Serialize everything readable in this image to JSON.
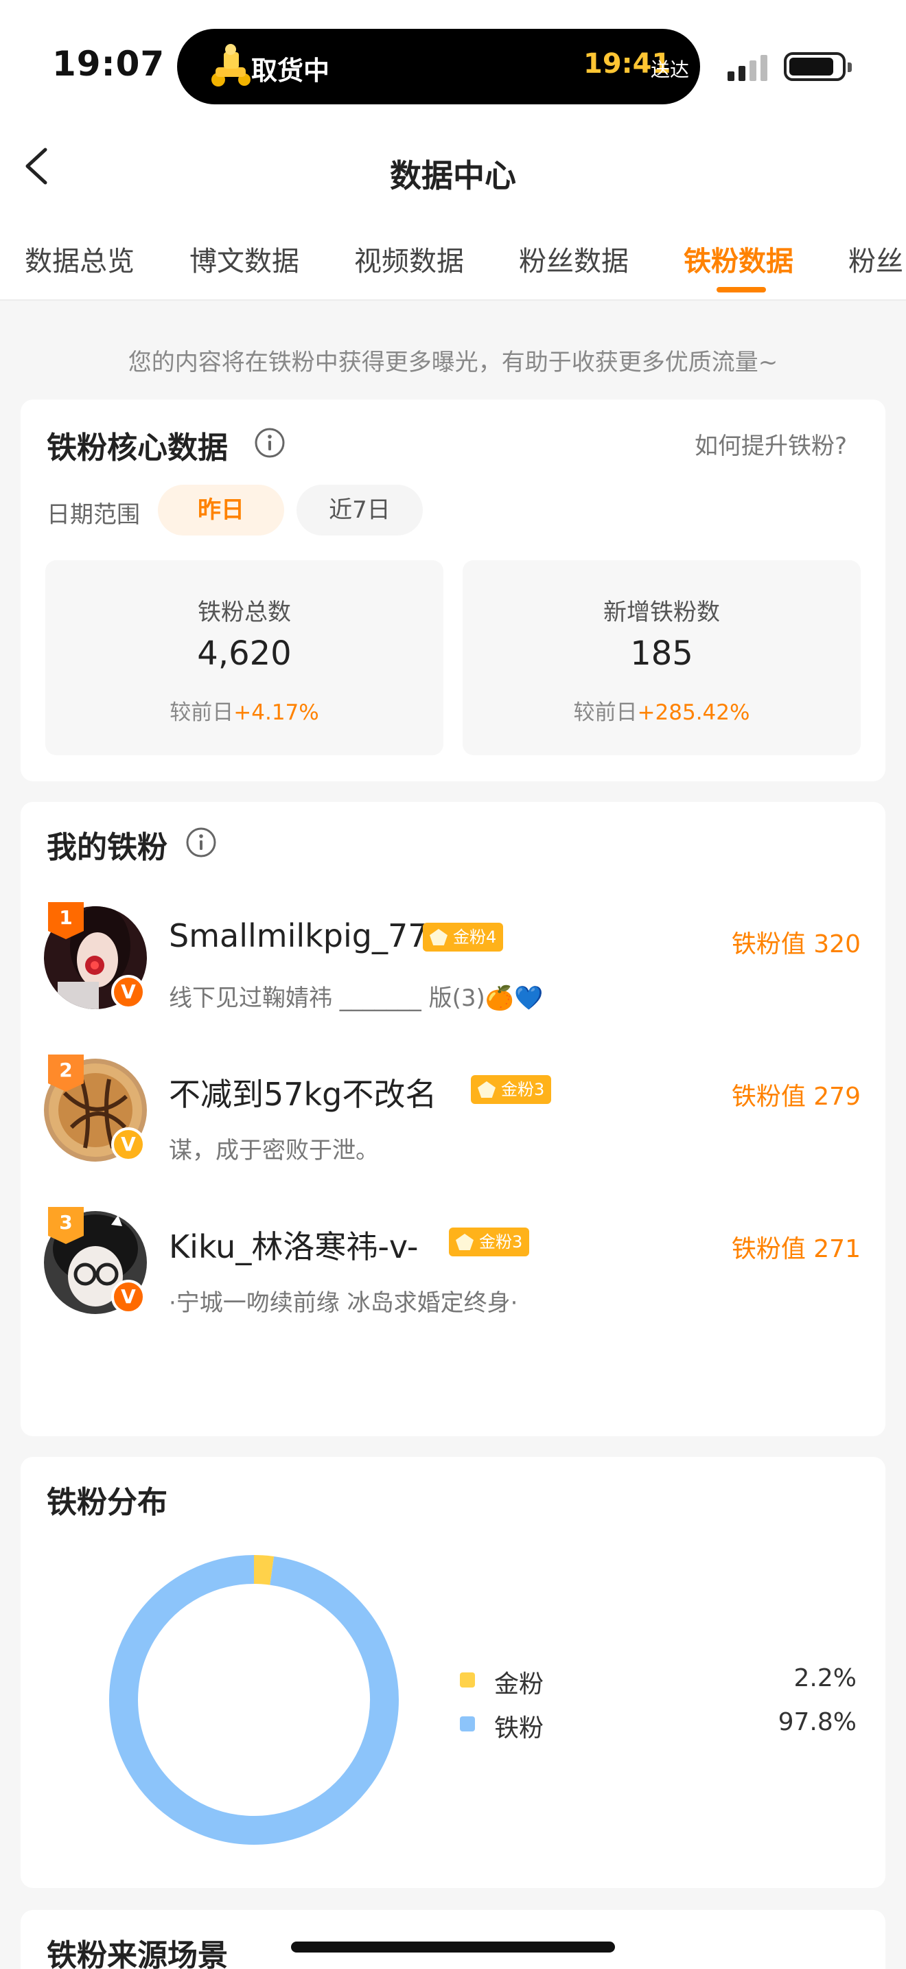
{
  "status_bar": {
    "time": "19:07",
    "island_status": "取货中",
    "island_eta": "19:41",
    "island_eta_suffix": "送达"
  },
  "header": {
    "title": "数据中心"
  },
  "tabs": [
    {
      "label": "数据总览"
    },
    {
      "label": "博文数据"
    },
    {
      "label": "视频数据"
    },
    {
      "label": "粉丝数据"
    },
    {
      "label": "铁粉数据",
      "active": true
    },
    {
      "label": "粉丝"
    }
  ],
  "tip": "您的内容将在铁粉中获得更多曝光，有助于收获更多优质流量~",
  "core": {
    "title": "铁粉核心数据",
    "help_link": "如何提升铁粉?",
    "range_label": "日期范围",
    "ranges": [
      {
        "label": "昨日",
        "active": true
      },
      {
        "label": "近7日"
      }
    ],
    "stats": [
      {
        "label": "铁粉总数",
        "value": "4,620",
        "cmp_prefix": "较前日",
        "cmp_change": "+4.17%"
      },
      {
        "label": "新增铁粉数",
        "value": "185",
        "cmp_prefix": "较前日",
        "cmp_change": "+285.42%"
      }
    ]
  },
  "fans": {
    "title": "我的铁粉",
    "list": [
      {
        "rank": "1",
        "name": "Smallmilkpig_77",
        "medal": "金粉4",
        "bio": "线下见过鞠婧祎 _______ 版(3)🍊💙",
        "value": "铁粉值 320"
      },
      {
        "rank": "2",
        "name": "不减到57kg不改名",
        "medal": "金粉3",
        "bio": "谋，成于密败于泄。",
        "value": "铁粉值 279"
      },
      {
        "rank": "3",
        "name": "Kiku_林洛寒祎-v-",
        "medal": "金粉3",
        "bio": "·宁城一吻续前缘 冰岛求婚定终身·",
        "value": "铁粉值 271"
      }
    ]
  },
  "distribution": {
    "title": "铁粉分布",
    "items": [
      {
        "name": "金粉",
        "percent": "2.2%",
        "value": 2.2,
        "color": "#ffd24a"
      },
      {
        "name": "铁粉",
        "percent": "97.8%",
        "value": 97.8,
        "color": "#8cc4fa"
      }
    ]
  },
  "source": {
    "title": "铁粉来源场景"
  },
  "colors": {
    "accent": "#ff8200",
    "medal": "#ffb21a",
    "rank": "#ff6a00"
  }
}
